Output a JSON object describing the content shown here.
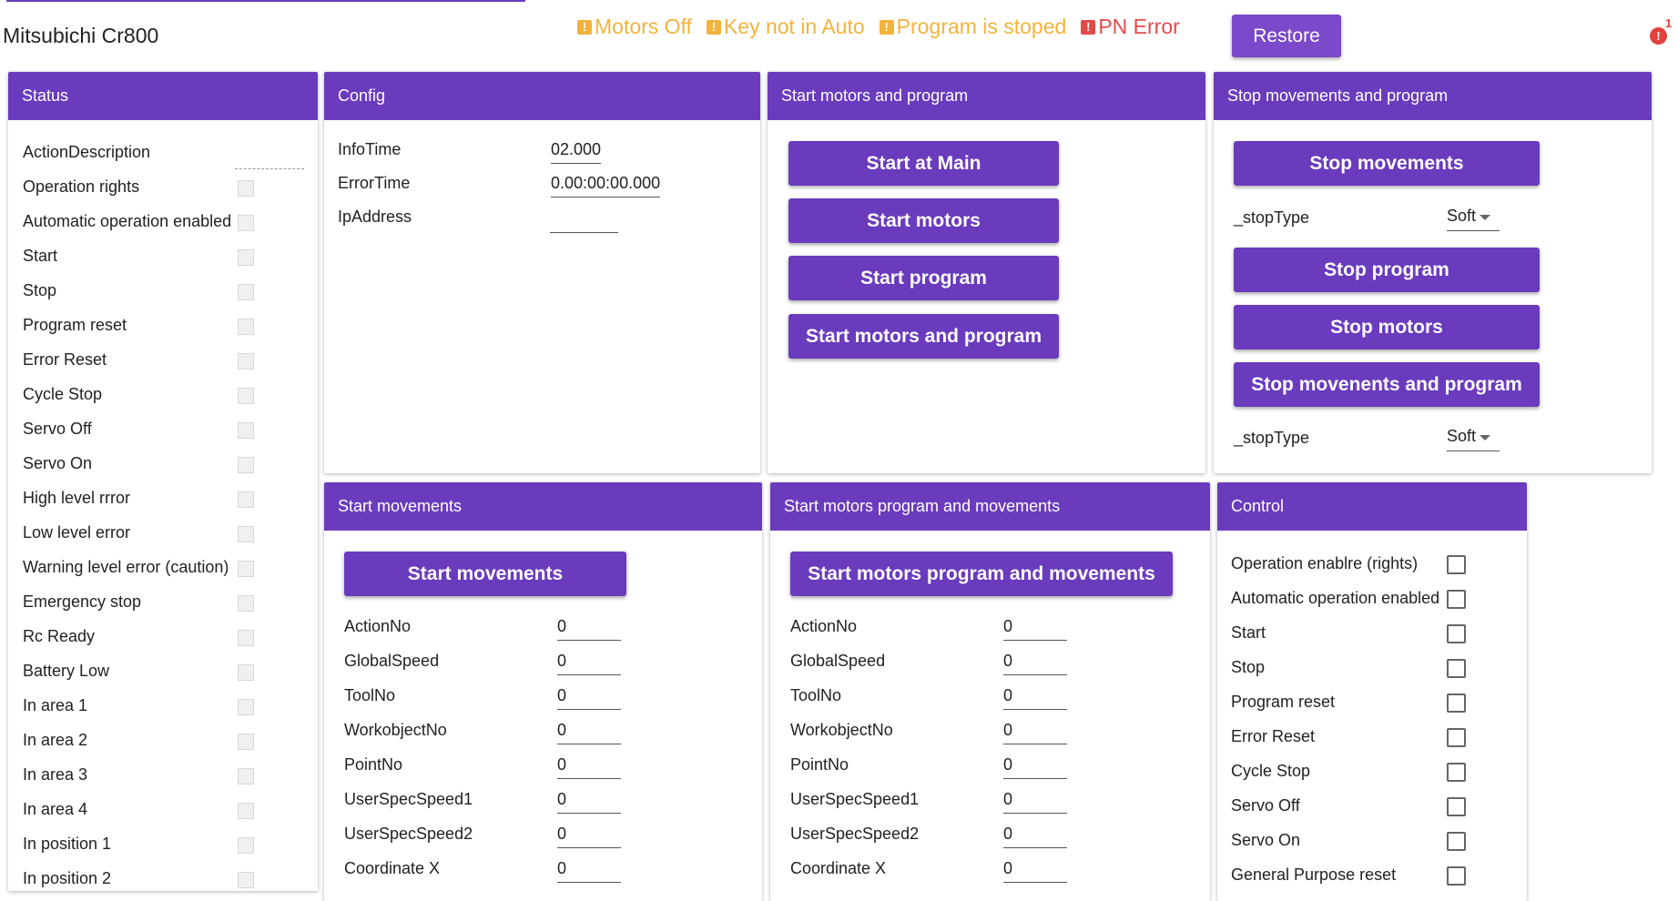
{
  "app": {
    "title": "Mitsubichi Cr800"
  },
  "alerts": [
    {
      "icon": "warning-icon",
      "glyph": "!",
      "text": "Motors Off",
      "kind": "warn"
    },
    {
      "icon": "warning-icon",
      "glyph": "!",
      "text": "Key not in Auto",
      "kind": "warn"
    },
    {
      "icon": "warning-icon",
      "glyph": "!",
      "text": "Program is stoped",
      "kind": "warn"
    },
    {
      "icon": "error-icon",
      "glyph": "!",
      "text": "PN Error",
      "kind": "err"
    }
  ],
  "colors": {
    "accent": "#6a3bbd",
    "warning": "#f2b33d",
    "error": "#e24a4a"
  },
  "restore_label": "Restore",
  "notifications": {
    "glyph": "!",
    "count": "1"
  },
  "status": {
    "title": "Status",
    "items": [
      "ActionDescription",
      "Operation rights",
      "Automatic operation enabled",
      "Start",
      "Stop",
      "Program reset",
      "Error Reset",
      "Cycle Stop",
      "Servo Off",
      "Servo On",
      "High level rrror",
      "Low level error",
      "Warning level error (caution)",
      "Emergency stop",
      "Rc Ready",
      "Battery Low",
      "In area 1",
      "In area 2",
      "In area 3",
      "In area 4",
      "In position 1",
      "In position 2"
    ]
  },
  "config": {
    "title": "Config",
    "fields": [
      {
        "label": "InfoTime",
        "value": "02.000"
      },
      {
        "label": "ErrorTime",
        "value": "0.00:00:00.000"
      },
      {
        "label": "IpAddress",
        "value": ""
      }
    ]
  },
  "start_panel": {
    "title": "Start motors and program",
    "buttons": [
      "Start at Main",
      "Start motors",
      "Start program",
      "Start motors and program"
    ]
  },
  "stop_panel": {
    "title": "Stop movements and program",
    "stop_movements": "Stop movements",
    "stop_type_label": "_stopType",
    "stop_type_value": "Soft",
    "stop_program": "Stop program",
    "stop_motors": "Stop motors",
    "stop_movents_program": "Stop movenents and program",
    "stop_type_label2": "_stopType",
    "stop_type_value2": "Soft"
  },
  "movements": {
    "title": "Start movements",
    "button": "Start movements",
    "fields": [
      {
        "label": "ActionNo",
        "value": "0"
      },
      {
        "label": "GlobalSpeed",
        "value": "0"
      },
      {
        "label": "ToolNo",
        "value": "0"
      },
      {
        "label": "WorkobjectNo",
        "value": "0"
      },
      {
        "label": "PointNo",
        "value": "0"
      },
      {
        "label": "UserSpecSpeed1",
        "value": "0"
      },
      {
        "label": "UserSpecSpeed2",
        "value": "0"
      },
      {
        "label": "Coordinate X",
        "value": "0"
      }
    ]
  },
  "motors_movements": {
    "title": "Start motors program and movements",
    "button": "Start motors program and movements",
    "fields": [
      {
        "label": "ActionNo",
        "value": "0"
      },
      {
        "label": "GlobalSpeed",
        "value": "0"
      },
      {
        "label": "ToolNo",
        "value": "0"
      },
      {
        "label": "WorkobjectNo",
        "value": "0"
      },
      {
        "label": "PointNo",
        "value": "0"
      },
      {
        "label": "UserSpecSpeed1",
        "value": "0"
      },
      {
        "label": "UserSpecSpeed2",
        "value": "0"
      },
      {
        "label": "Coordinate X",
        "value": "0"
      }
    ]
  },
  "control": {
    "title": "Control",
    "items": [
      "Operation enablre (rights)",
      "Automatic operation enabled",
      "Start",
      "Stop",
      "Program reset",
      "Error Reset",
      "Cycle Stop",
      "Servo Off",
      "Servo On",
      "General Purpose reset"
    ]
  }
}
